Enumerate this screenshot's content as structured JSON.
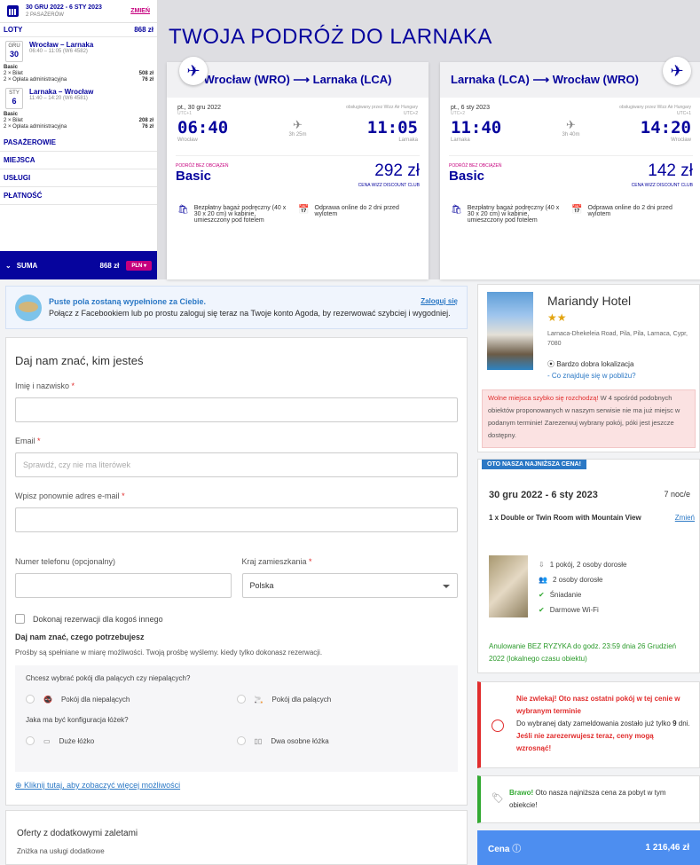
{
  "wizz": {
    "dates": "30 GRU 2022 - 6 STY 2023",
    "pax": "2 PASAŻERÓW",
    "change": "ZMIEŃ",
    "flights_label": "LOTY",
    "flights_total": "868 zł",
    "f1": {
      "mon": "GRU",
      "day": "30",
      "route": "Wrocław – Larnaka",
      "info": "06:40 – 11:05 (W6 4582)",
      "fare": "Basic",
      "l1": "2 × Bilet",
      "v1": "508 zł",
      "l2": "2 × Opłata administracyjna",
      "v2": "76 zł"
    },
    "f2": {
      "mon": "STY",
      "day": "6",
      "route": "Larnaka – Wrocław",
      "info": "11:40 – 14:20 (W6 4581)",
      "fare": "Basic",
      "l1": "2 × Bilet",
      "v1": "208 zł",
      "l2": "2 × Opłata administracyjna",
      "v2": "76 zł"
    },
    "sections": [
      "PASAŻEROWIE",
      "MIEJSCA",
      "USŁUGI",
      "PŁATNOŚĆ"
    ],
    "sum_label": "SUMA",
    "sum_total": "868 zł",
    "currency": "PLN",
    "heading": "TWOJA PODRÓŻ DO LARNAKA",
    "out": {
      "title": "Wrocław (WRO) ⟶ Larnaka (LCA)",
      "date": "pt., 30 gru 2022",
      "op": "obsługiwany przez Wizz Air Hungary",
      "dep": "06:40",
      "arr": "11:05",
      "dur": "3h 25m",
      "from": "Wrocław",
      "to": "Larnaka",
      "fare_lbl": "PODRÓŻ BEZ OBCIĄŻEŃ",
      "fare": "Basic",
      "price": "292 zł",
      "club": "CENA WIZZ DISCOUNT CLUB"
    },
    "ret": {
      "title": "Larnaka (LCA) ⟶ Wrocław (WRO)",
      "date": "pt., 6 sty 2023",
      "op": "obsługiwany przez Wizz Air Hungary",
      "dep": "11:40",
      "arr": "14:20",
      "dur": "3h 40m",
      "from": "Larnaka",
      "to": "Wrocław",
      "fare_lbl": "PODRÓŻ BEZ OBCIĄŻEŃ",
      "fare": "Basic",
      "price": "142 zł",
      "club": "CENA WIZZ DISCOUNT CLUB"
    },
    "feat_bag": "Bezpłatny bagaż podręczny (40 x 30 x 20 cm) w kabinie, umieszczony pod fotelem",
    "feat_checkin": "Odprawa online do 2 dni przed wylotem",
    "utc": "UTC+1",
    "utc2": "UTC+2"
  },
  "agoda": {
    "banner_title": "Puste pola zostaną wypełnione za Ciebie.",
    "banner_text": "Połącz z Facebookiem lub po prostu zaloguj się teraz na Twoje konto Agoda, by rezerwować szybciej i wygodniej.",
    "login": "Zaloguj się",
    "form_title": "Daj nam znać, kim jesteś",
    "name_label": "Imię i nazwisko",
    "email_label": "Email",
    "email_ph": "Sprawdź, czy nie ma literówek",
    "email2_label": "Wpisz ponownie adres e-mail",
    "phone_label": "Numer telefonu (opcjonalny)",
    "country_label": "Kraj zamieszkania",
    "country": "Polska",
    "other": "Dokonaj rezerwacji dla kogoś innego",
    "needs_title": "Daj nam znać, czego potrzebujesz",
    "needs_text": "Prośby są spełniane w miarę możliwości. Twoją prośbę wyślemy. kiedy tylko dokonasz rezerwacji.",
    "smoke_q": "Chcesz wybrać pokój dla palących czy niepalących?",
    "nonsmoke": "Pokój dla niepalących",
    "smoke": "Pokój dla palących",
    "bed_q": "Jaka ma być konfiguracja łóżek?",
    "big_bed": "Duże łóżko",
    "twin": "Dwa osobne łóżka",
    "more": "Kliknij tutaj, aby zobaczyć więcej możliwości",
    "offers_title": "Oferty z dodatkowymi zaletami",
    "offers_sub": "Zniżka na usługi dodatkowe",
    "hotel_name": "Mariandy Hotel",
    "stars": "★★",
    "address": "Larnaca-Dhekeleia Road, Pila, Pila, Larnaca, Cypr, 7080",
    "location": "Bardzo dobra lokalizacja",
    "nearby": "- Co znajduje się w pobliżu?",
    "warn_red": "Wolne miejsca szybko się rozchodzą!",
    "warn_text": "W 4 spośród podobnych obiektów proponowanych w naszym serwisie nie ma już miejsc w podanym terminie! Zarezerwuj wybrany pokój, póki jest jeszcze dostępny.",
    "tag": "OTO NASZA NAJNIŻSZA CENA!",
    "dates": "30 gru 2022 - 6 sty 2023",
    "nights": "7 noc/e",
    "room": "1 x Double or Twin Room with Mountain View",
    "change": "Zmień",
    "amen": [
      "1 pokój, 2 osoby dorosłe",
      "2 osoby dorosłe",
      "Śniadanie",
      "Darmowe Wi-Fi"
    ],
    "cancel": "Anulowanie BEZ RYZYKA do godz. 23:59 dnia 26 Grudzień 2022 (lokalnego czasu obiektu)",
    "last_red": "Nie zwlekaj! Oto nasz ostatni pokój w tej cenie w wybranym terminie",
    "last_a": "Do wybranej daty zameldowania zostało już tylko",
    "last_n": "9",
    "last_b": "dni.",
    "last_red2": "Jeśli nie zarezerwujesz teraz, ceny mogą wzrosnąć!",
    "bravo": "Brawo!",
    "bravo_text": "Oto nasza najniższa cena za pobyt w tym obiekcie!",
    "price_label": "Cena",
    "price": "1 216,46 zł"
  }
}
